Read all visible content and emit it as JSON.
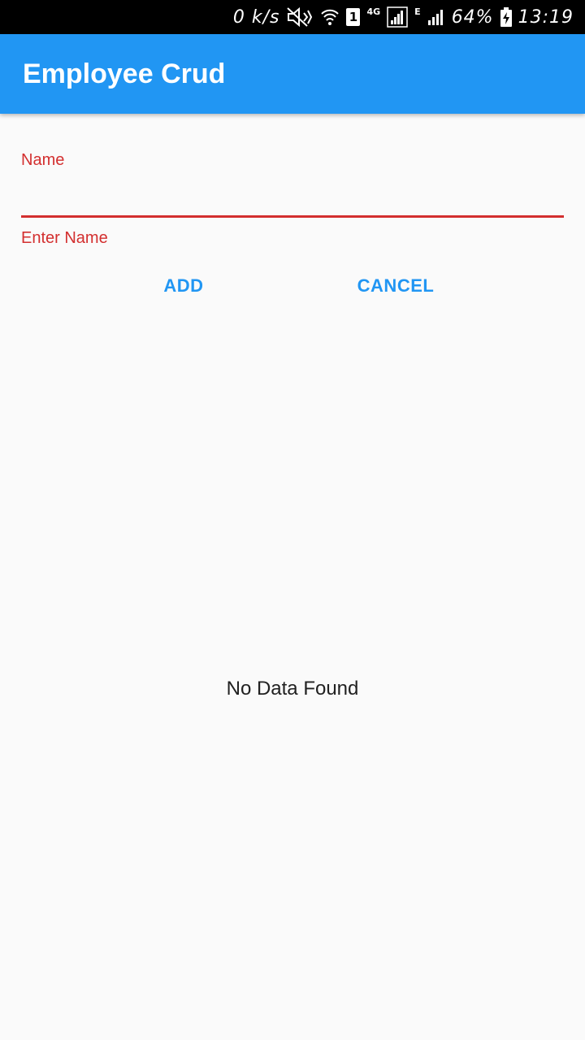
{
  "status_bar": {
    "speed": "0 k/s",
    "sim": "1",
    "network_4g": "4G",
    "network_e": "E",
    "battery": "64%",
    "time": "13:19"
  },
  "app_bar": {
    "title": "Employee Crud"
  },
  "form": {
    "name_label": "Name",
    "name_value": "",
    "error_text": "Enter Name",
    "add_label": "ADD",
    "cancel_label": "CANCEL"
  },
  "list": {
    "empty_text": "No Data Found"
  },
  "colors": {
    "primary": "#2196f3",
    "error": "#d32f2f",
    "background": "#fafafa"
  }
}
